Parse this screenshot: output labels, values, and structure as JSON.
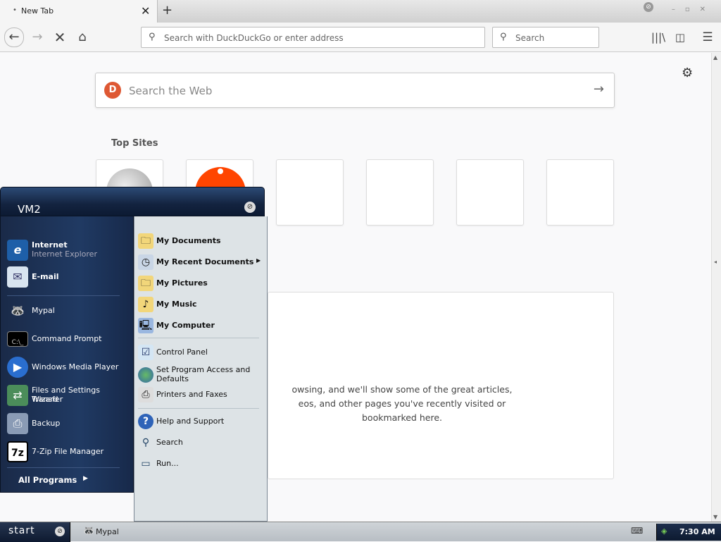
{
  "browser": {
    "tab": {
      "title": "New Tab",
      "close": "✕"
    },
    "new_tab": "+",
    "url_placeholder": "Search with DuckDuckGo or enter address",
    "search_placeholder": "Search"
  },
  "page": {
    "web_search_placeholder": "Search the Web",
    "top_sites_heading": "Top Sites",
    "highlights_text_line1": "owsing, and we'll show some of the great articles,",
    "highlights_text_line2": "eos, and other pages you've recently visited or",
    "highlights_text_line3": "bookmarked here."
  },
  "start_menu": {
    "user": "VM2",
    "pinned": [
      {
        "title": "Internet",
        "subtitle": "Internet Explorer",
        "icon": "internet-explorer-icon"
      },
      {
        "title": "E-mail",
        "icon": "email-icon"
      }
    ],
    "recent": [
      {
        "label": "Mypal",
        "icon": "mypal-icon"
      },
      {
        "label": "Command Prompt",
        "icon": "command-prompt-icon"
      },
      {
        "label": "Windows Media Player",
        "icon": "media-player-icon"
      },
      {
        "label": "Files and Settings Transfer",
        "label2": "Wizard",
        "icon": "transfer-wizard-icon"
      },
      {
        "label": "Backup",
        "icon": "backup-icon"
      },
      {
        "label": "7-Zip File Manager",
        "icon": "7zip-icon"
      }
    ],
    "all_programs": "All Programs",
    "right": [
      {
        "label": "My Documents"
      },
      {
        "label": "My Recent Documents"
      },
      {
        "label": "My Pictures"
      },
      {
        "label": "My Music"
      },
      {
        "label": "My Computer"
      },
      {
        "label": "Control Panel"
      },
      {
        "label": "Set Program Access and",
        "label2": "Defaults"
      },
      {
        "label": "Printers and Faxes"
      },
      {
        "label": "Help and Support"
      },
      {
        "label": "Search"
      },
      {
        "label": "Run..."
      }
    ]
  },
  "taskbar": {
    "start": "start",
    "task": "Mypal",
    "clock": "7:30 AM"
  }
}
